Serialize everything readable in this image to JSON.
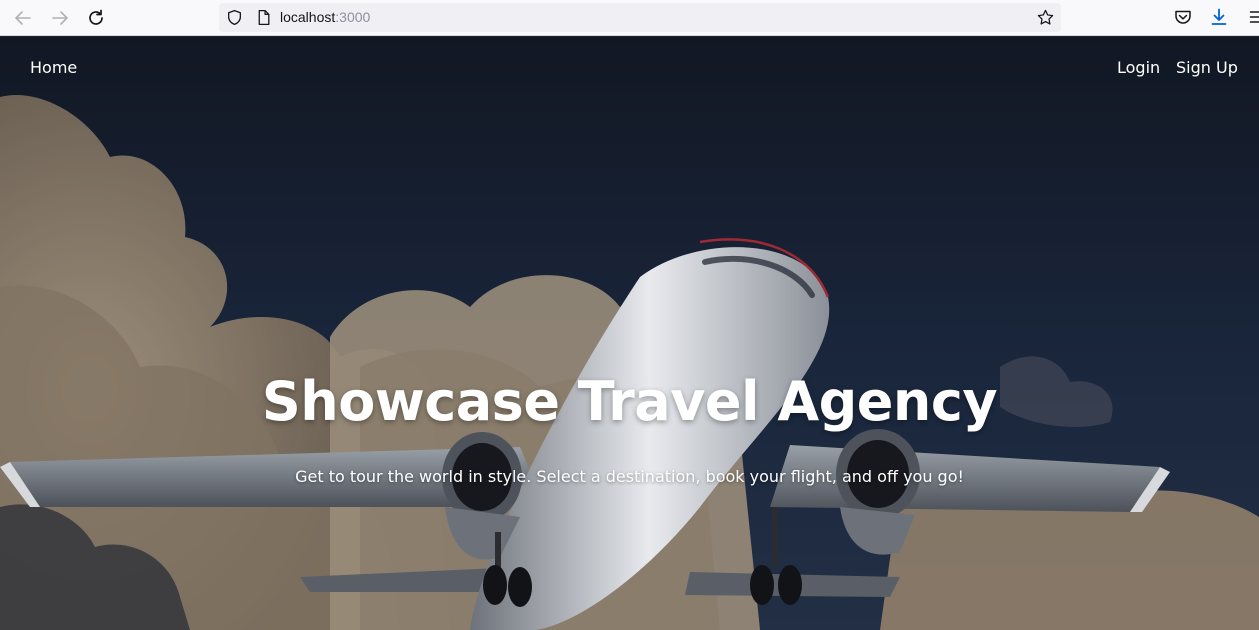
{
  "browser": {
    "url_host": "localhost",
    "url_port": ":3000",
    "icons": {
      "back": "arrow-left-icon",
      "forward": "arrow-right-icon",
      "reload": "reload-icon",
      "tracking": "shield-icon",
      "page": "page-icon",
      "bookmark": "star-icon",
      "pocket": "pocket-icon",
      "downloads": "download-icon",
      "menu": "hamburger-menu-icon"
    },
    "accent_color": "#0060df"
  },
  "nav": {
    "home": "Home",
    "login": "Login",
    "signup": "Sign Up"
  },
  "hero": {
    "title": "Showcase Travel Agency",
    "subtitle": "Get to tour the world in style. Select a destination, book your flight, and off you go!",
    "background_image": "airplane taking off among clouds",
    "text_color": "#ffffff"
  }
}
